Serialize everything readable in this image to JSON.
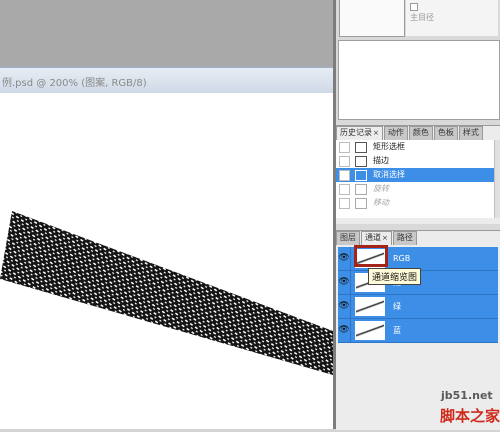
{
  "document": {
    "title": "例.psd @ 200% (图案, RGB/8)"
  },
  "navigator": {
    "label": "主目径"
  },
  "history": {
    "tabs": [
      {
        "label": "历史记录",
        "close": "×"
      },
      {
        "label": "动作"
      },
      {
        "label": "颜色"
      },
      {
        "label": "色板"
      },
      {
        "label": "样式"
      }
    ],
    "items": [
      {
        "label": "矩形选框",
        "state": "normal"
      },
      {
        "label": "描边",
        "state": "normal"
      },
      {
        "label": "取消选择",
        "state": "selected"
      },
      {
        "label": "旋转",
        "state": "disabled"
      },
      {
        "label": "移动",
        "state": "disabled"
      }
    ]
  },
  "channels": {
    "tabs": [
      {
        "label": "图层"
      },
      {
        "label": "通道",
        "close": "×"
      },
      {
        "label": "路径"
      }
    ],
    "items": [
      {
        "label": "RGB"
      },
      {
        "label": "红"
      },
      {
        "label": "绿"
      },
      {
        "label": "蓝"
      }
    ],
    "tooltip": "通道缩览图"
  },
  "watermark": {
    "url": "jb51.net",
    "text": "脚本之家"
  },
  "colors": {
    "selection_blue": "#3d8ee6",
    "highlight_red": "#a4241a",
    "watermark_red": "#cf2a1c"
  }
}
